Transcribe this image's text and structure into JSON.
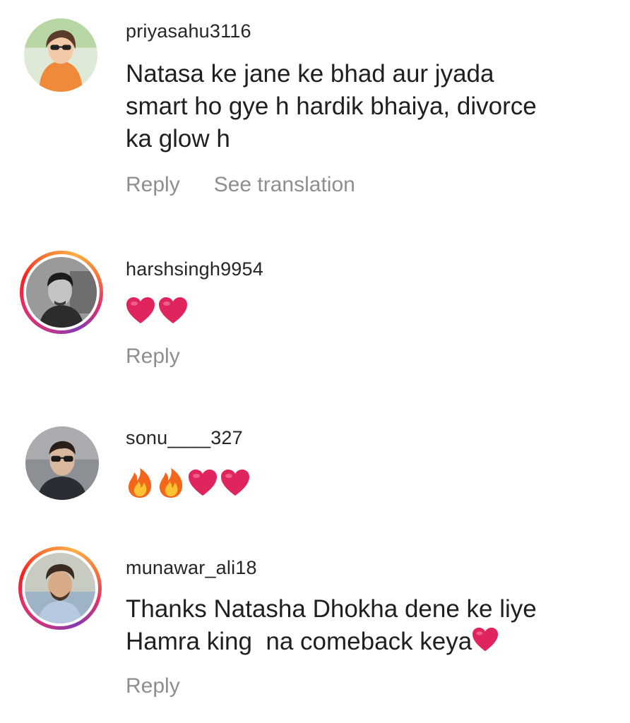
{
  "comments": [
    {
      "username": "priyasahu3116",
      "text_lines": [
        "Natasa ke jane ke bhad aur jyada",
        "smart ho gye h hardik bhaiya, divorce",
        "ka glow h"
      ],
      "emojis": [],
      "actions": [
        "Reply",
        "See translation"
      ],
      "avatar": "profile-photo-girl-orange",
      "story_ring": false
    },
    {
      "username": "harshsingh9954",
      "text_lines": [],
      "emojis": [
        "red-heart",
        "red-heart"
      ],
      "actions": [
        "Reply"
      ],
      "avatar": "profile-photo-man-grayscale",
      "story_ring": true
    },
    {
      "username": "sonu____327",
      "text_lines": [],
      "emojis": [
        "fire",
        "fire",
        "red-heart",
        "red-heart"
      ],
      "actions": [],
      "avatar": "profile-photo-man-sunglasses",
      "story_ring": false
    },
    {
      "username": "munawar_ali18",
      "text_lines": [
        "Thanks Natasha Dhokha dene ke liye",
        "Hamra king  na comeback keya"
      ],
      "trailing_emoji": "red-heart",
      "emojis": [],
      "actions": [
        "Reply"
      ],
      "avatar": "profile-photo-man-beard",
      "story_ring": true
    }
  ],
  "colors": {
    "username": "#262626",
    "text": "#1f1f1f",
    "action": "#8e8e8e",
    "heart": "#e0245e",
    "story_ring_start": "#c13584",
    "story_ring_end": "#fcaf45"
  }
}
